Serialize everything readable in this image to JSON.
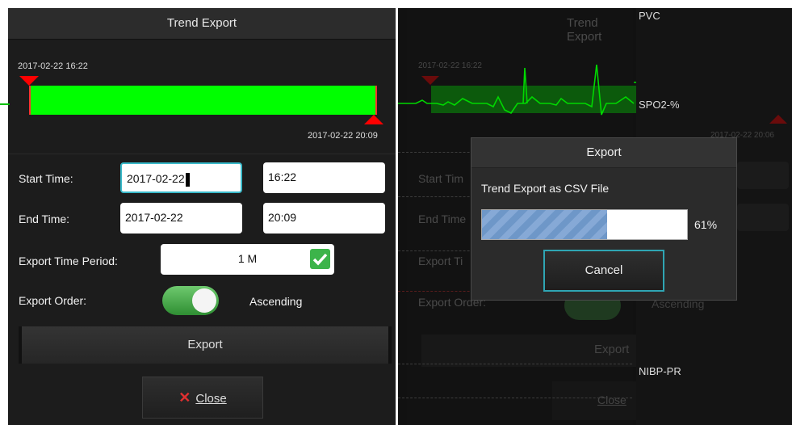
{
  "trend_dialog": {
    "title": "Trend Export",
    "range_start_label": "2017-02-22 16:22",
    "range_end_label": "2017-02-22 20:09",
    "start_time_label": "Start Time:",
    "start_date": "2017-02-22",
    "start_clock": "16:22",
    "end_time_label": "End Time:",
    "end_date": "2017-02-22",
    "end_clock": "20:09",
    "period_label": "Export Time Period:",
    "period_value": "1 M",
    "order_label": "Export Order:",
    "order_value": "Ascending",
    "export_button": "Export",
    "close_button": "Close"
  },
  "background": {
    "dim_title": "Trend Export",
    "dim_range_start": "2017-02-22 16:22",
    "dim_range_end": "2017-02-22 20:06",
    "dim_start_label": "Start Tim",
    "dim_end_label": "End Time",
    "dim_period_label": "Export Ti",
    "dim_order_label": "Export Order:",
    "dim_order_value": "Ascending",
    "dim_export": "Export",
    "dim_close": "Close",
    "param_pvc": "PVC",
    "param_spo2": "SPO2-%",
    "param_nibp": "NIBP-PR"
  },
  "export_dialog": {
    "title": "Export",
    "message": "Trend Export as CSV File",
    "progress": 0.61,
    "progress_label": "61%",
    "cancel_button": "Cancel"
  },
  "colors": {
    "accent_green": "#00ff00",
    "marker_red": "#ff0000",
    "check_green": "#3cb44a",
    "progress_blue": "#6e97c8"
  }
}
